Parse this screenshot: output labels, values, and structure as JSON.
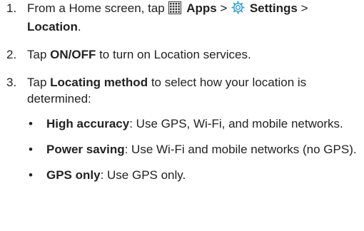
{
  "steps": [
    {
      "num": "1.",
      "t1": "From a Home screen, tap ",
      "apps_icon": "apps-grid-icon",
      "apps": "Apps",
      "sep1": " > ",
      "settings_icon": "settings-gear-icon",
      "settings": "Settings",
      "sep2": " >",
      "location": "Location",
      "end": "."
    },
    {
      "num": "2.",
      "t1": "Tap ",
      "onoff": "ON/OFF",
      "t2": " to turn on Location services."
    },
    {
      "num": "3.",
      "t1": "Tap ",
      "method": "Locating method",
      "t2": " to select how your location is determined:"
    }
  ],
  "bullets": [
    {
      "dot": "•",
      "term": "High accuracy",
      "desc": ": Use GPS, Wi-Fi, and mobile networks."
    },
    {
      "dot": "•",
      "term": "Power saving",
      "desc": ": Use Wi-Fi and mobile networks (no GPS)."
    },
    {
      "dot": "•",
      "term": "GPS only",
      "desc": ": Use GPS only."
    }
  ],
  "colors": {
    "text": "#222222",
    "settings_icon": "#3aa3c8"
  }
}
